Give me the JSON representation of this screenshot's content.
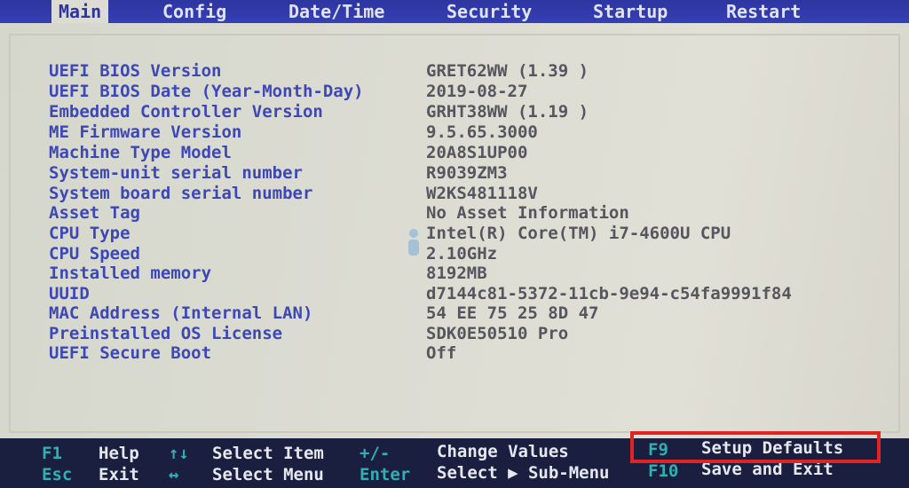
{
  "tabs": [
    {
      "label": "Main",
      "active": true
    },
    {
      "label": "Config",
      "active": false
    },
    {
      "label": "Date/Time",
      "active": false
    },
    {
      "label": "Security",
      "active": false
    },
    {
      "label": "Startup",
      "active": false
    },
    {
      "label": "Restart",
      "active": false
    }
  ],
  "main": {
    "rows": [
      {
        "label": "UEFI BIOS Version",
        "value": "GRET62WW (1.39 )"
      },
      {
        "label": "UEFI BIOS Date (Year-Month-Day)",
        "value": "2019-08-27"
      },
      {
        "label": "Embedded Controller Version",
        "value": "GRHT38WW (1.19 )"
      },
      {
        "label": "ME Firmware Version",
        "value": "9.5.65.3000"
      },
      {
        "label": "Machine Type Model",
        "value": "20A8S1UP00"
      },
      {
        "label": "System-unit serial number",
        "value": "R9039ZM3"
      },
      {
        "label": "System board serial number",
        "value": "W2KS481118V"
      },
      {
        "label": "Asset Tag",
        "value": "No Asset Information"
      },
      {
        "label": "CPU Type",
        "value": "Intel(R) Core(TM) i7-4600U CPU"
      },
      {
        "label": "CPU Speed",
        "value": "2.10GHz"
      },
      {
        "label": "Installed memory",
        "value": "8192MB"
      },
      {
        "label": "UUID",
        "value": "d7144c81-5372-11cb-9e94-c54fa9991f84"
      },
      {
        "label": "MAC Address (Internal LAN)",
        "value": "54 EE 75 25 8D 47"
      },
      {
        "label": "Preinstalled OS License",
        "value": "SDK0E50510 Pro"
      },
      {
        "label": "UEFI Secure Boot",
        "value": "Off"
      }
    ]
  },
  "help": {
    "f1_key": "F1",
    "f1_desc": "Help",
    "updown_key": "↑↓",
    "updown_desc": "Select Item",
    "plusminus_key": "+/-",
    "plusminus_desc": "Change Values",
    "f9_key": "F9",
    "f9_desc": "Setup Defaults",
    "esc_key": "Esc",
    "esc_desc": "Exit",
    "leftright_key": "↔",
    "leftright_desc": "Select Menu",
    "enter_key": "Enter",
    "enter_desc": "Select ▶ Sub-Menu",
    "f10_key": "F10",
    "f10_desc": "Save and Exit"
  },
  "colors": {
    "tab_bar": "#2d35a0",
    "panel_bg": "#dcdcd3",
    "label": "#3e48b5",
    "value": "#55565e",
    "help_bg": "#1b1f3f",
    "help_key": "#2fb0b4",
    "highlight": "#e02424"
  }
}
